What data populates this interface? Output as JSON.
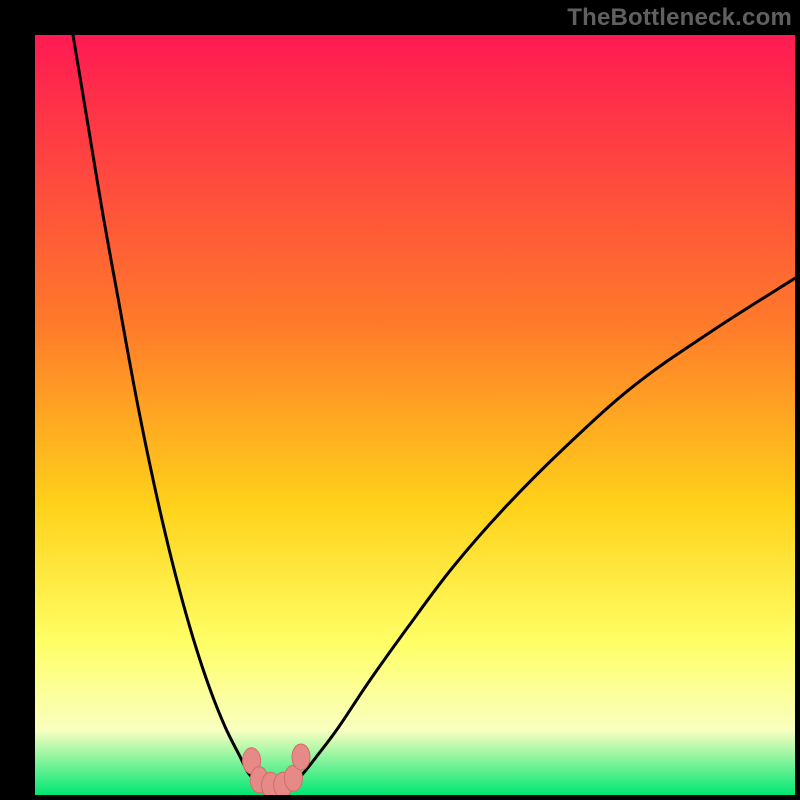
{
  "watermark": "TheBottleneck.com",
  "colors": {
    "frame": "#000000",
    "grad_top": "#ff1a52",
    "grad_mid1": "#ff7a2a",
    "grad_mid2": "#ffd21a",
    "grad_mid3": "#ffff66",
    "grad_mid4": "#f9ffc0",
    "grad_bottom": "#00e673",
    "curve": "#000000",
    "marker_fill": "#e58a86",
    "marker_stroke": "#d86b66"
  },
  "chart_data": {
    "type": "line",
    "title": "",
    "xlabel": "",
    "ylabel": "",
    "xlim": [
      0,
      100
    ],
    "ylim": [
      0,
      100
    ],
    "series": [
      {
        "name": "left-branch",
        "x": [
          5,
          7,
          9,
          11,
          13,
          15,
          17,
          19,
          21,
          23,
          25,
          27,
          28,
          29,
          30
        ],
        "y": [
          100,
          88,
          76,
          65,
          54,
          44,
          35,
          27,
          20,
          14,
          9,
          5,
          3,
          2,
          1.5
        ]
      },
      {
        "name": "right-branch",
        "x": [
          34,
          35,
          37,
          40,
          44,
          49,
          55,
          62,
          70,
          79,
          89,
          100
        ],
        "y": [
          1.5,
          2.5,
          5,
          9,
          15,
          22,
          30,
          38,
          46,
          54,
          61,
          68
        ]
      },
      {
        "name": "bottom-flat",
        "x": [
          30,
          31,
          32,
          33,
          34
        ],
        "y": [
          1.5,
          1.2,
          1.1,
          1.2,
          1.5
        ]
      }
    ],
    "markers": [
      {
        "x": 28.5,
        "y": 4.5
      },
      {
        "x": 29.5,
        "y": 2.0
      },
      {
        "x": 31.0,
        "y": 1.3
      },
      {
        "x": 32.6,
        "y": 1.3
      },
      {
        "x": 34.0,
        "y": 2.2
      },
      {
        "x": 35.0,
        "y": 5.0
      }
    ]
  }
}
